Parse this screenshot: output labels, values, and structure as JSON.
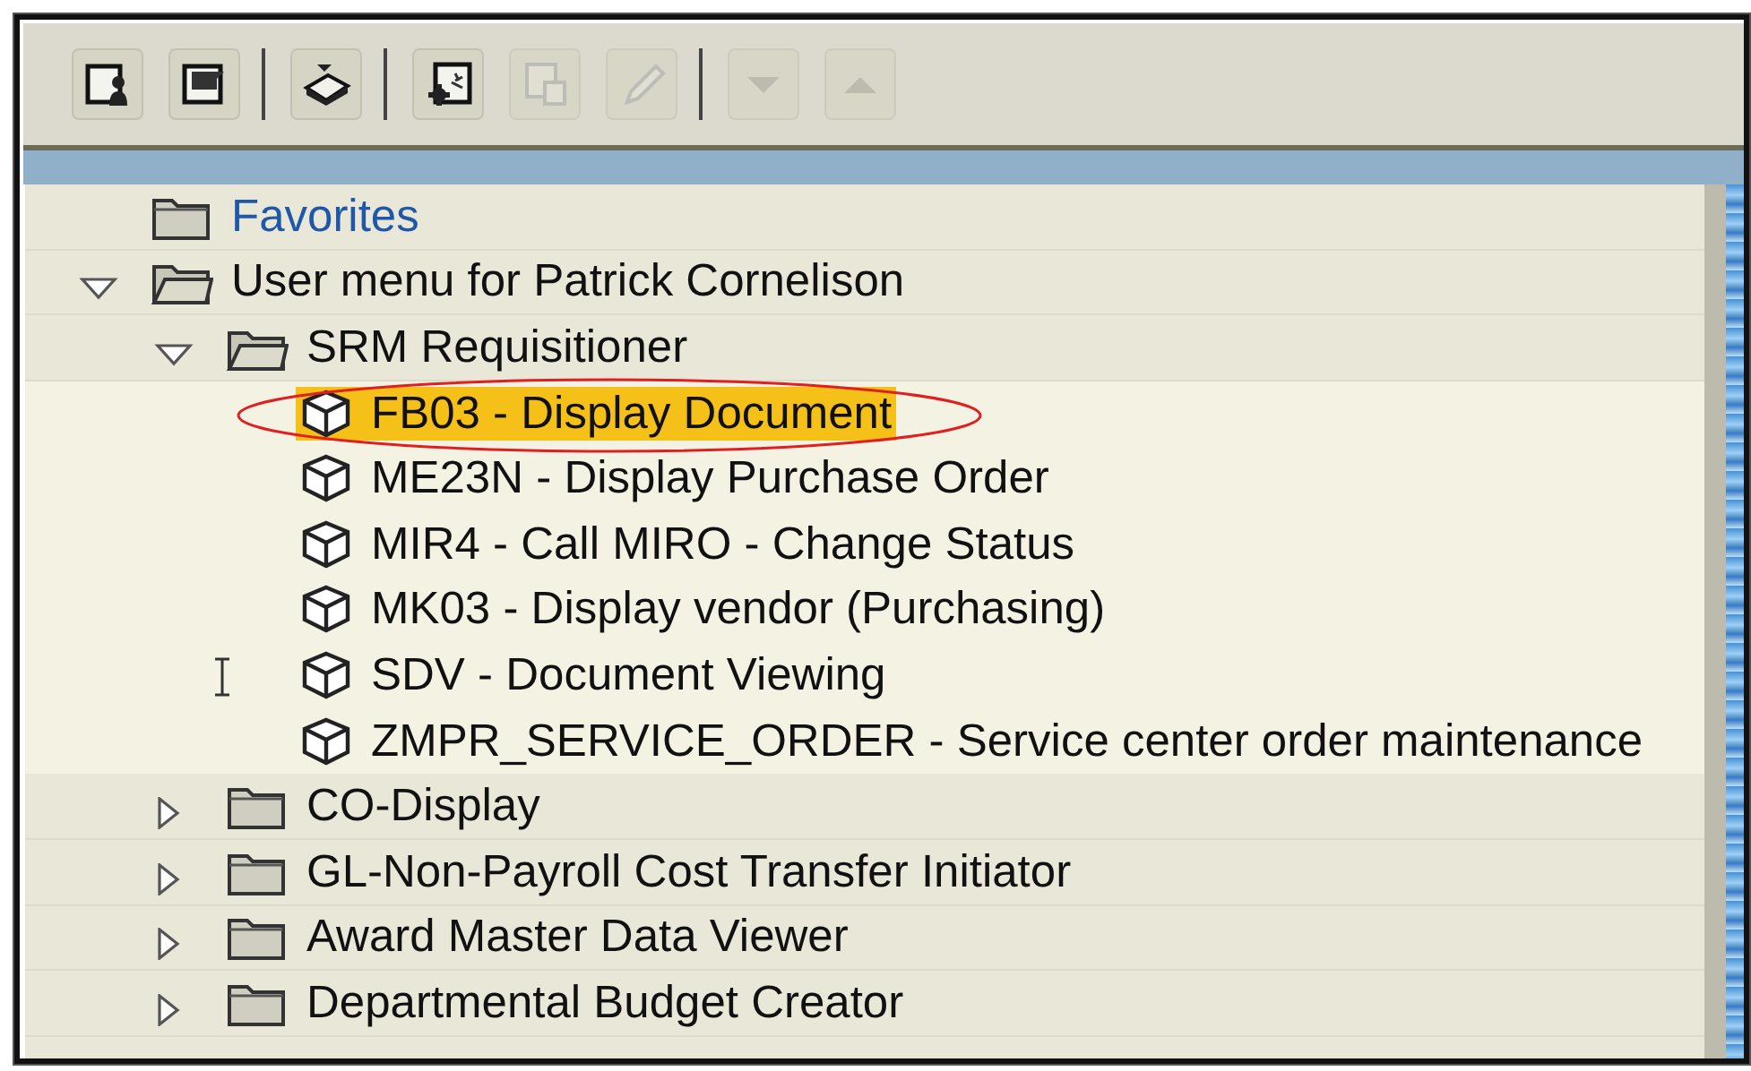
{
  "toolbar": {
    "groups": [
      [
        {
          "disabled": false
        },
        {
          "disabled": false
        }
      ],
      [
        {
          "disabled": false
        }
      ],
      [
        {
          "disabled": false
        },
        {
          "disabled": true
        },
        {
          "disabled": true
        }
      ],
      [
        {
          "disabled": true
        },
        {
          "disabled": true
        }
      ]
    ]
  },
  "tree": [
    {
      "label": "Favorites",
      "kind": "folder",
      "link": true,
      "selected": false
    },
    {
      "label": "User menu for Patrick Cornelison",
      "kind": "folder",
      "expanded": true,
      "selected": false,
      "children": [
        {
          "label": "SRM Requisitioner",
          "kind": "folder",
          "expanded": true,
          "selected": false,
          "children": [
            {
              "label": "FB03 - Display Document",
              "kind": "transaction",
              "selected": true,
              "circled": true
            },
            {
              "label": "ME23N - Display Purchase Order",
              "kind": "transaction",
              "selected": false
            },
            {
              "label": "MIR4 - Call MIRO - Change Status",
              "kind": "transaction",
              "selected": false
            },
            {
              "label": "MK03 - Display vendor (Purchasing)",
              "kind": "transaction",
              "selected": false
            },
            {
              "label": "SDV - Document Viewing",
              "kind": "transaction",
              "selected": false
            },
            {
              "label": "ZMPR_SERVICE_ORDER - Service center order maintenance",
              "kind": "transaction",
              "selected": false
            }
          ]
        },
        {
          "label": "CO-Display",
          "kind": "folder",
          "expanded": false,
          "selected": false
        },
        {
          "label": "GL-Non-Payroll Cost Transfer Initiator",
          "kind": "folder",
          "expanded": false,
          "selected": false
        },
        {
          "label": "Award Master Data Viewer",
          "kind": "folder",
          "expanded": false,
          "selected": false
        },
        {
          "label": "Departmental Budget Creator",
          "kind": "folder",
          "expanded": false,
          "selected": false
        }
      ]
    }
  ]
}
